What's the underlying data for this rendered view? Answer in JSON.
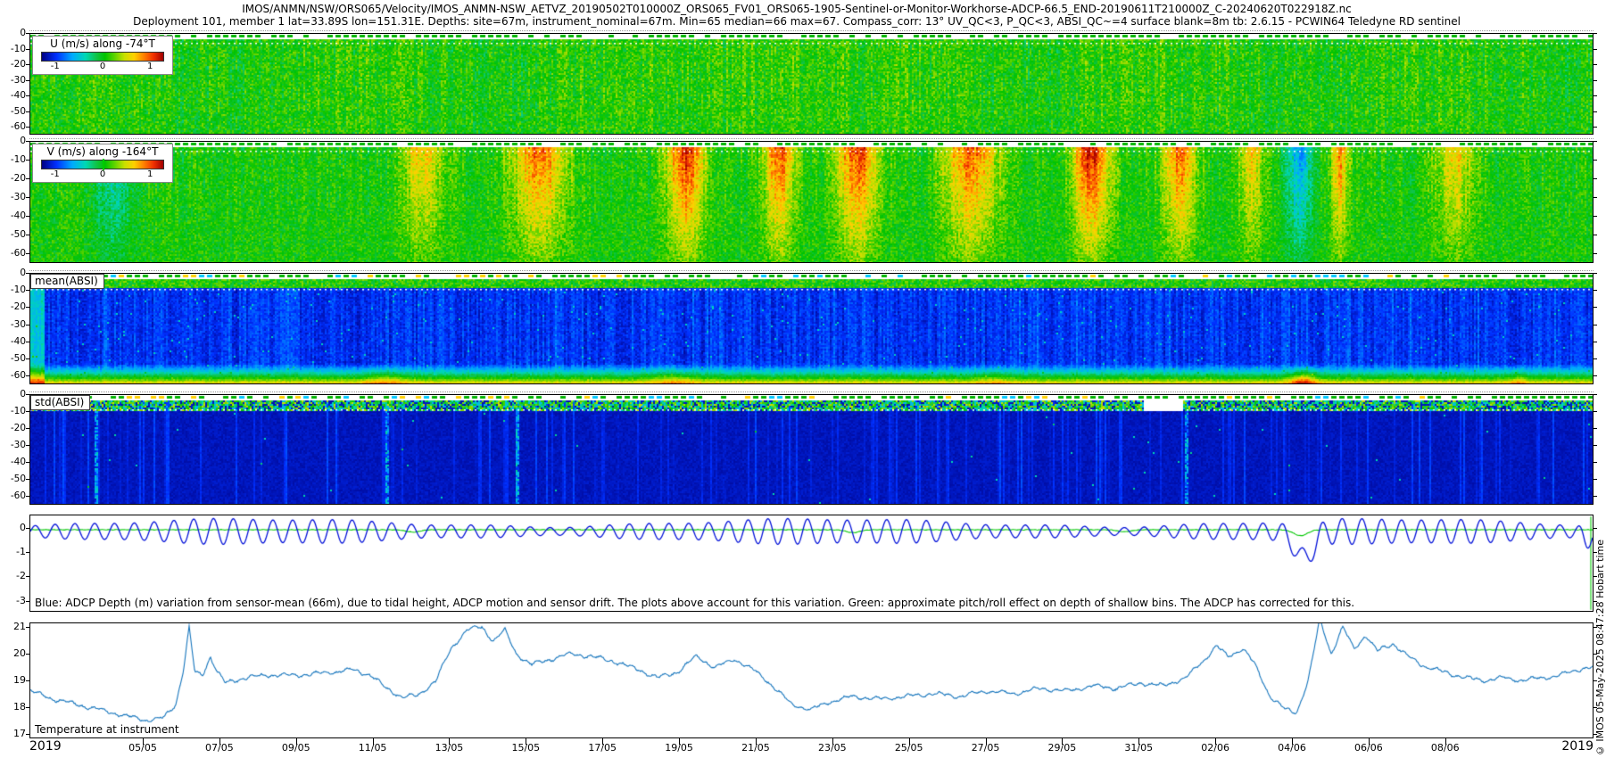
{
  "header": {
    "title_line1": "IMOS/ANMN/NSW/ORS065/Velocity/IMOS_ANMN-NSW_AETVZ_20190502T010000Z_ORS065_FV01_ORS065-1905-Sentinel-or-Monitor-Workhorse-ADCP-66.5_END-20190611T210000Z_C-20240620T022918Z.nc",
    "title_line2": "Deployment 101, member 1 lat=33.89S lon=151.31E. Depths: site=67m, instrument_nominal=67m. Min=65 median=66 max=67. Compass_corr: 13° UV_QC<3, P_QC<3, ABSI_QC~=4 surface blank=8m tb: 2.6.15 - PCWIN64 Teledyne RD sentinel"
  },
  "watermark": "© IMOS 05-May-2025 08:47:28 Hobart time",
  "x_axis": {
    "year_label_left": "2019",
    "year_label_right": "2019",
    "tick_labels": [
      "05/05",
      "07/05",
      "09/05",
      "11/05",
      "13/05",
      "15/05",
      "17/05",
      "19/05",
      "21/05",
      "23/05",
      "25/05",
      "27/05",
      "29/05",
      "31/05",
      "02/06",
      "04/06",
      "06/06",
      "08/06"
    ],
    "span_days": 40.83,
    "tick_start_day": 2.958,
    "tick_step_days": 2
  },
  "chart_data": [
    {
      "type": "heatmap",
      "id": "u_velocity",
      "legend_title": "U (m/s) along -74°T",
      "colorbar_ticks": [
        "-1",
        "0",
        "1"
      ],
      "clim": [
        -1.43,
        1.43
      ],
      "ylim_depth_m": [
        -65,
        0
      ],
      "yticks": [
        0,
        -10,
        -20,
        -30,
        -40,
        -50,
        -60
      ],
      "features": {
        "yellow_pulses_days": [
          [
            17,
            22,
            0.15
          ],
          [
            27,
            29,
            0.1
          ]
        ],
        "cyan_fleck_days": [
          0,
          2.5
        ]
      },
      "description": "Across-shelf velocity component vs depth and time; mostly near zero (green) with fine vertical streak noise."
    },
    {
      "type": "heatmap",
      "id": "v_velocity",
      "legend_title": "V (m/s) along -164°T",
      "colorbar_ticks": [
        "-1",
        "0",
        "1"
      ],
      "clim": [
        -1.43,
        1.43
      ],
      "ylim_depth_m": [
        -65,
        0
      ],
      "yticks": [
        0,
        -10,
        -20,
        -30,
        -40,
        -50,
        -60
      ],
      "features": {
        "positive_pulses_days": [
          [
            9.2,
            11.3,
            0.55
          ],
          [
            12.0,
            14.6,
            0.8
          ],
          [
            16.2,
            18.0,
            1.0
          ],
          [
            18.8,
            20.3,
            0.9
          ],
          [
            20.6,
            22.6,
            0.95
          ],
          [
            23.3,
            25.8,
            0.85
          ],
          [
            26.8,
            28.6,
            1.05
          ],
          [
            29.2,
            30.8,
            0.8
          ],
          [
            31.3,
            32.5,
            0.6
          ],
          [
            33.8,
            34.6,
            0.75
          ],
          [
            36.2,
            38.2,
            0.55
          ]
        ],
        "negative_pulses_days": [
          [
            32.55,
            33.75,
            -0.7
          ],
          [
            1.2,
            3.0,
            -0.45
          ]
        ]
      },
      "description": "Along-shelf velocity; strong surface-intensified poleward pulses (yellow/orange/red) through the deployment and a brief negative (cyan) event near 03-04/06."
    },
    {
      "type": "heatmap",
      "id": "mean_absi",
      "label": "mean(ABSI)",
      "ylim_depth_m": [
        -65,
        0
      ],
      "yticks": [
        0,
        -10,
        -20,
        -30,
        -40,
        -50,
        -60
      ],
      "features": {
        "bottom_hotspots_days": [
          [
            8.3,
            10.2,
            0.4
          ],
          [
            15.6,
            18.0,
            0.35
          ],
          [
            24.3,
            26.0,
            0.25
          ],
          [
            32.6,
            33.9,
            0.8
          ],
          [
            38.4,
            39.3,
            0.35
          ]
        ]
      },
      "description": "Mean acoustic backscatter: low (dark blue) in the interior, high (green/yellow/orange) in the near-surface bins and in a band near the seabed."
    },
    {
      "type": "heatmap",
      "id": "std_absi",
      "label": "std(ABSI)",
      "ylim_depth_m": [
        -65,
        0
      ],
      "yticks": [
        0,
        -10,
        -20,
        -30,
        -40,
        -50,
        -60
      ],
      "features": {
        "bright_columns_days": [
          1.7,
          9.3,
          12.7,
          30.2
        ],
        "speckle_gap_days": [
          29.1,
          30.1
        ]
      },
      "description": "Standard deviation of backscatter: very low (dark navy) with sparse brighter vertical streaks and a colourful speckled surface row."
    },
    {
      "type": "line",
      "id": "depth_variation",
      "yticks": [
        0,
        -1,
        -2,
        -3
      ],
      "ylim": [
        -3.45,
        0.55
      ],
      "annotation": "Blue: ADCP Depth (m) variation from sensor-mean (66m), due to tidal height, ADCP motion and sensor drift. The plots above account for this variation. Green: approximate pitch/roll effect on depth of shallow bins. The ADCP has corrected for this.",
      "colors": {
        "blue": "#0010d8",
        "green": "#00c800"
      },
      "blue_series": {
        "name": "ADCP depth variation (m)",
        "mean_offset_m": -0.12,
        "tidal_period_days": 0.5175,
        "amplitude_mid_m": 0.36,
        "amplitude_mod_m": 0.16,
        "spring_neap_period_days": 14.8,
        "event_dip": {
          "day": 33.28,
          "extra_m": -1.15
        },
        "end_dip": {
          "day": 40.68,
          "extra_m": -0.5
        }
      },
      "green_series": {
        "name": "pitch/roll depth effect (m)",
        "base_m": -0.05,
        "dips_day_m": [
          [
            10.0,
            -0.1
          ],
          [
            21.5,
            -0.12
          ],
          [
            28.6,
            -0.08
          ],
          [
            33.2,
            -0.25
          ]
        ],
        "end_spike_day": 40.78
      }
    },
    {
      "type": "line",
      "id": "temperature",
      "label": "Temperature at instrument",
      "yticks": [
        21,
        20,
        19,
        18,
        17
      ],
      "ylim": [
        16.85,
        21.15
      ],
      "color": "#1474bc",
      "points_day_degC": [
        [
          0,
          18.6
        ],
        [
          0.6,
          18.3
        ],
        [
          1.2,
          18.1
        ],
        [
          1.8,
          17.9
        ],
        [
          2.4,
          17.7
        ],
        [
          3.0,
          17.5
        ],
        [
          3.5,
          17.6
        ],
        [
          3.8,
          18.1
        ],
        [
          4.0,
          19.4
        ],
        [
          4.15,
          21.0
        ],
        [
          4.3,
          19.3
        ],
        [
          4.5,
          19.2
        ],
        [
          4.7,
          19.9
        ],
        [
          4.9,
          19.3
        ],
        [
          5.1,
          18.9
        ],
        [
          5.6,
          19.1
        ],
        [
          6.2,
          19.2
        ],
        [
          7.0,
          19.2
        ],
        [
          7.8,
          19.3
        ],
        [
          8.4,
          19.4
        ],
        [
          8.9,
          19.2
        ],
        [
          9.3,
          18.7
        ],
        [
          9.7,
          18.4
        ],
        [
          10.1,
          18.4
        ],
        [
          10.6,
          19.0
        ],
        [
          11.0,
          20.2
        ],
        [
          11.4,
          20.9
        ],
        [
          11.8,
          21.0
        ],
        [
          12.1,
          20.5
        ],
        [
          12.4,
          20.9
        ],
        [
          12.7,
          20.0
        ],
        [
          13.1,
          19.6
        ],
        [
          13.6,
          19.8
        ],
        [
          14.1,
          20.0
        ],
        [
          14.7,
          19.9
        ],
        [
          15.3,
          19.7
        ],
        [
          15.9,
          19.4
        ],
        [
          16.4,
          19.1
        ],
        [
          16.9,
          19.3
        ],
        [
          17.4,
          19.9
        ],
        [
          17.9,
          19.5
        ],
        [
          18.4,
          19.8
        ],
        [
          18.9,
          19.4
        ],
        [
          19.4,
          18.8
        ],
        [
          19.9,
          18.1
        ],
        [
          20.4,
          17.9
        ],
        [
          20.9,
          18.2
        ],
        [
          21.5,
          18.4
        ],
        [
          22.2,
          18.3
        ],
        [
          22.9,
          18.4
        ],
        [
          23.6,
          18.5
        ],
        [
          24.3,
          18.4
        ],
        [
          25.0,
          18.6
        ],
        [
          25.7,
          18.5
        ],
        [
          26.4,
          18.7
        ],
        [
          27.1,
          18.6
        ],
        [
          27.8,
          18.8
        ],
        [
          28.4,
          18.7
        ],
        [
          29.0,
          18.9
        ],
        [
          29.6,
          18.8
        ],
        [
          30.2,
          19.1
        ],
        [
          30.7,
          19.8
        ],
        [
          31.0,
          20.3
        ],
        [
          31.3,
          19.9
        ],
        [
          31.7,
          20.2
        ],
        [
          32.0,
          19.6
        ],
        [
          32.4,
          18.4
        ],
        [
          32.8,
          17.9
        ],
        [
          33.1,
          17.8
        ],
        [
          33.4,
          19.0
        ],
        [
          33.7,
          21.3
        ],
        [
          34.0,
          20.0
        ],
        [
          34.3,
          21.0
        ],
        [
          34.6,
          20.2
        ],
        [
          34.9,
          20.7
        ],
        [
          35.2,
          20.1
        ],
        [
          35.6,
          20.4
        ],
        [
          36.0,
          19.9
        ],
        [
          36.5,
          19.5
        ],
        [
          37.0,
          19.3
        ],
        [
          37.5,
          19.1
        ],
        [
          38.0,
          19.0
        ],
        [
          38.5,
          19.1
        ],
        [
          39.0,
          19.0
        ],
        [
          39.5,
          19.1
        ],
        [
          40.0,
          19.2
        ],
        [
          40.4,
          19.4
        ],
        [
          40.8,
          19.5
        ]
      ]
    }
  ]
}
